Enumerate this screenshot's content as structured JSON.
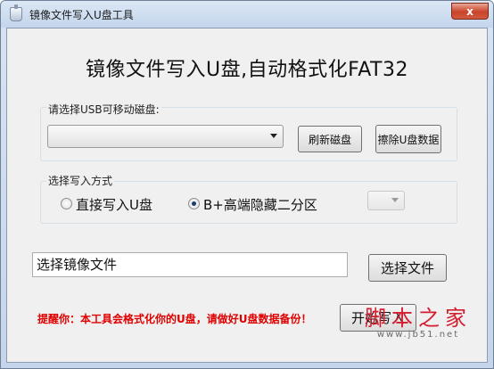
{
  "window": {
    "title": "镜像文件写入U盘工具",
    "close_label": "x"
  },
  "headline": "镜像文件写入U盘,自动格式化FAT32",
  "usb_group": {
    "label": "请选择USB可移动磁盘:",
    "selected": "",
    "refresh_label": "刷新磁盘",
    "erase_label": "擦除U盘数据"
  },
  "write_group": {
    "label": "选择写入方式",
    "option_direct": "直接写入U盘",
    "option_hidden": "B+高端隐藏二分区",
    "selected_option": "B+高端隐藏二分区"
  },
  "image": {
    "path_text": "选择镜像文件",
    "choose_label": "选择文件"
  },
  "warning_text": "提醒你：本工具会格式化你的U盘，请做好U盘数据备份！",
  "start_label": "开始写入",
  "watermark": {
    "main": "脚本之家",
    "sub": "www.jb51.net"
  }
}
